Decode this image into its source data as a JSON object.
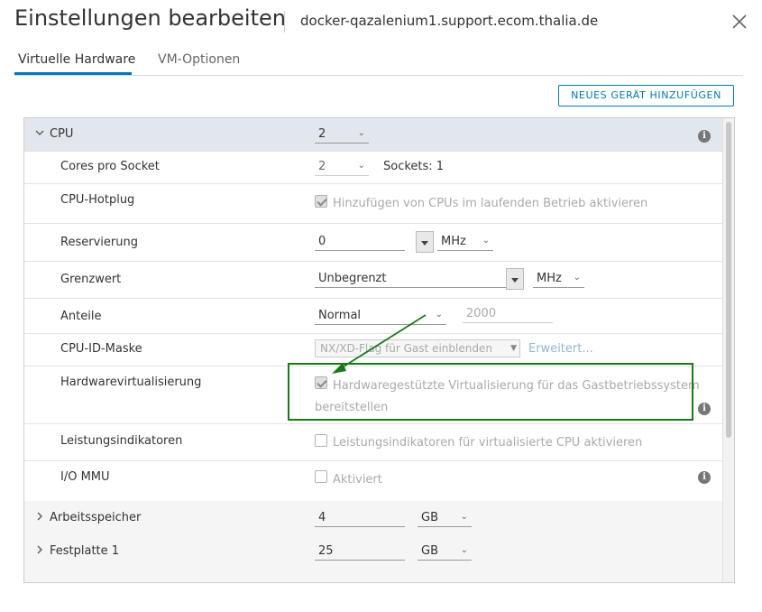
{
  "dialog": {
    "title": "Einstellungen bearbeiten",
    "vm_name": "docker-qazalenium1.support.ecom.thalia.de"
  },
  "tabs": [
    {
      "label": "Virtuelle Hardware",
      "active": true
    },
    {
      "label": "VM-Optionen",
      "active": false
    }
  ],
  "toolbar": {
    "add_device_label": "NEUES GERÄT HINZUFÜGEN"
  },
  "cpu": {
    "label": "CPU",
    "value": "2",
    "cores_per_socket": {
      "label": "Cores pro Socket",
      "value": "2",
      "sockets_text": "Sockets: 1"
    },
    "hotplug": {
      "label": "CPU-Hotplug",
      "checked": true,
      "text": "Hinzufügen von CPUs im laufenden Betrieb aktivieren"
    },
    "reservation": {
      "label": "Reservierung",
      "value": "0",
      "unit": "MHz"
    },
    "limit": {
      "label": "Grenzwert",
      "value": "Unbegrenzt",
      "unit": "MHz"
    },
    "shares": {
      "label": "Anteile",
      "value": "Normal",
      "number": "2000"
    },
    "id_mask": {
      "label": "CPU-ID-Maske",
      "value": "NX/XD-Flag für Gast einblenden",
      "link": "Erweitert..."
    },
    "hw_virt": {
      "label": "Hardwarevirtualisierung",
      "checked": true,
      "text_line1": "Hardwaregestützte Virtualisierung für das Gastbetriebssystem",
      "text_line2": "bereitstellen"
    },
    "perf_counters": {
      "label": "Leistungsindikatoren",
      "checked": false,
      "text": "Leistungsindikatoren für virtualisierte CPU aktivieren"
    },
    "iommu": {
      "label": "I/O MMU",
      "checked": false,
      "text": "Aktiviert"
    }
  },
  "memory": {
    "label": "Arbeitsspeicher",
    "value": "4",
    "unit": "GB"
  },
  "disk1": {
    "label": "Festplatte 1",
    "value": "25",
    "unit": "GB"
  },
  "colors": {
    "accent": "#0079b8",
    "annotation": "#1a7a1a"
  }
}
